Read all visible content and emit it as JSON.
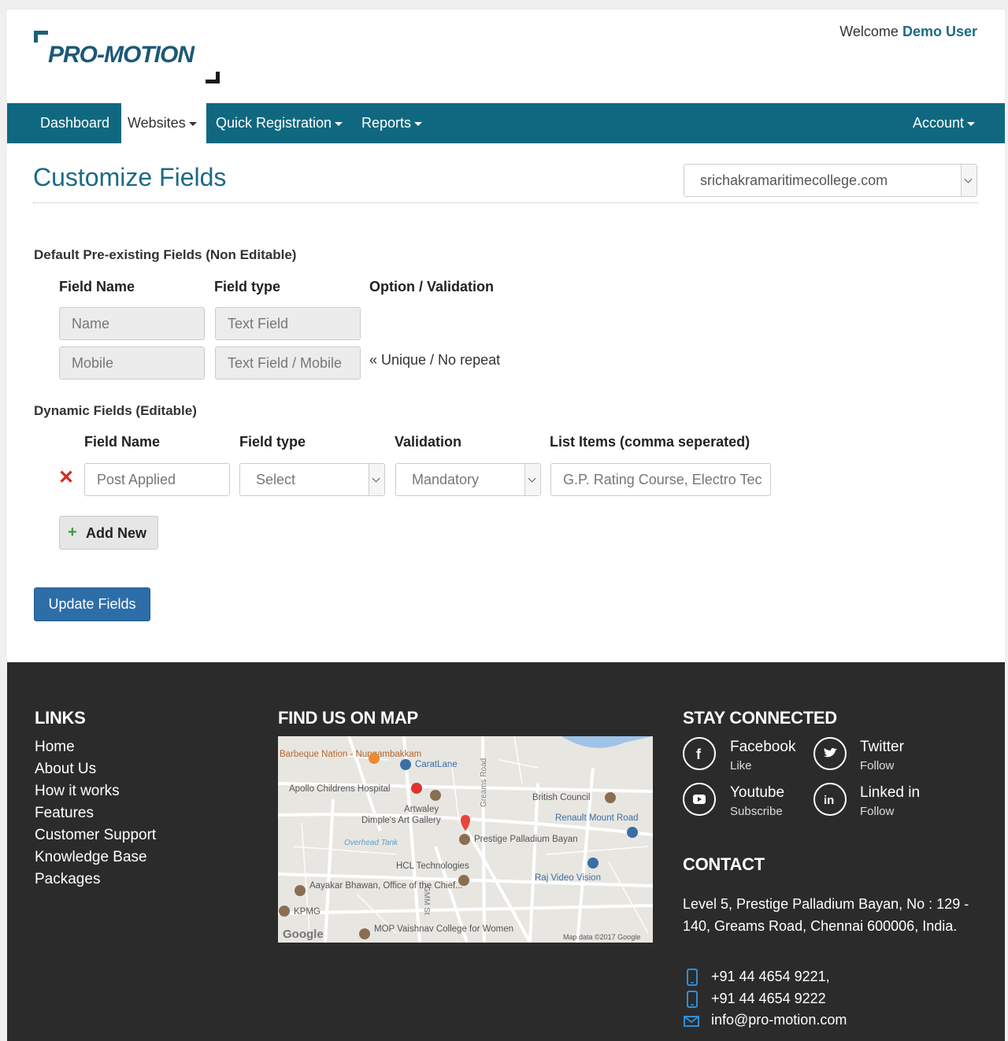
{
  "header": {
    "logo_text": "PRO-MOTION",
    "welcome_prefix": "Welcome",
    "user_name": "Demo User"
  },
  "nav": {
    "items": [
      {
        "label": "Dashboard",
        "active": false
      },
      {
        "label": "Websites",
        "active": true,
        "dropdown": true
      },
      {
        "label": "Quick Registration",
        "active": false,
        "dropdown": true
      },
      {
        "label": "Reports",
        "active": false,
        "dropdown": true
      }
    ],
    "account_label": "Account"
  },
  "page": {
    "title": "Customize Fields",
    "site_selected": "srichakramaritimecollege.com"
  },
  "default_fields": {
    "heading": "Default Pre-existing Fields (Non Editable)",
    "columns": [
      "Field Name",
      "Field type",
      "Option / Validation"
    ],
    "rows": [
      {
        "name": "Name",
        "type": "Text Field",
        "option": ""
      },
      {
        "name": "Mobile",
        "type": "Text Field / Mobile",
        "option": "« Unique / No repeat"
      }
    ]
  },
  "dynamic_fields": {
    "heading": "Dynamic Fields (Editable)",
    "columns": [
      "Field Name",
      "Field type",
      "Validation",
      "List Items (comma seperated)"
    ],
    "rows": [
      {
        "name": "Post Applied",
        "type": "Select",
        "validation": "Mandatory",
        "list_items": "G.P. Rating Course, Electro Tec"
      }
    ],
    "add_label": "Add New",
    "update_label": "Update Fields"
  },
  "footer": {
    "links_heading": "LINKS",
    "links": [
      "Home",
      "About Us",
      "How it works",
      "Features",
      "Customer Support",
      "Knowledge Base",
      "Packages"
    ],
    "map_heading": "FIND US ON MAP",
    "map_labels": [
      "Barbeque Nation - Nungambakkam",
      "CaratLane",
      "Apollo Childrens Hospital",
      "Greams Road",
      "British Council",
      "Artwaley",
      "Dimple's Art Gallery",
      "Renault Mount Road",
      "Prestige Palladium Bayan",
      "Overhead Tank",
      "HCL Technologies",
      "Raj Video Vision",
      "Aayakar Bhawan, Office of the Chief...",
      "GMM St",
      "KPMG",
      "MOP Vaishnav College for Women",
      "Google",
      "Map data ©2017 Google"
    ],
    "social_heading": "STAY CONNECTED",
    "social": [
      {
        "name": "Facebook",
        "action": "Like",
        "icon": "facebook-icon"
      },
      {
        "name": "Twitter",
        "action": "Follow",
        "icon": "twitter-icon"
      },
      {
        "name": "Youtube",
        "action": "Subscribe",
        "icon": "youtube-icon"
      },
      {
        "name": "Linked in",
        "action": "Follow",
        "icon": "linkedin-icon"
      }
    ],
    "contact_heading": "CONTACT",
    "address": "Level 5, Prestige Palladium Bayan, No : 129 - 140, Greams Road, Chennai 600006, India.",
    "phone1": "+91 44 4654 9221,",
    "phone2": "+91 44 4654 9222",
    "email": "info@pro-motion.com"
  },
  "colors": {
    "brand": "#106880",
    "title": "#1c6a86",
    "primary_button": "#2d6ea8",
    "footer_bg": "#2b2b2b",
    "danger": "#d9281e",
    "icon_blue": "#2f8fd8"
  }
}
